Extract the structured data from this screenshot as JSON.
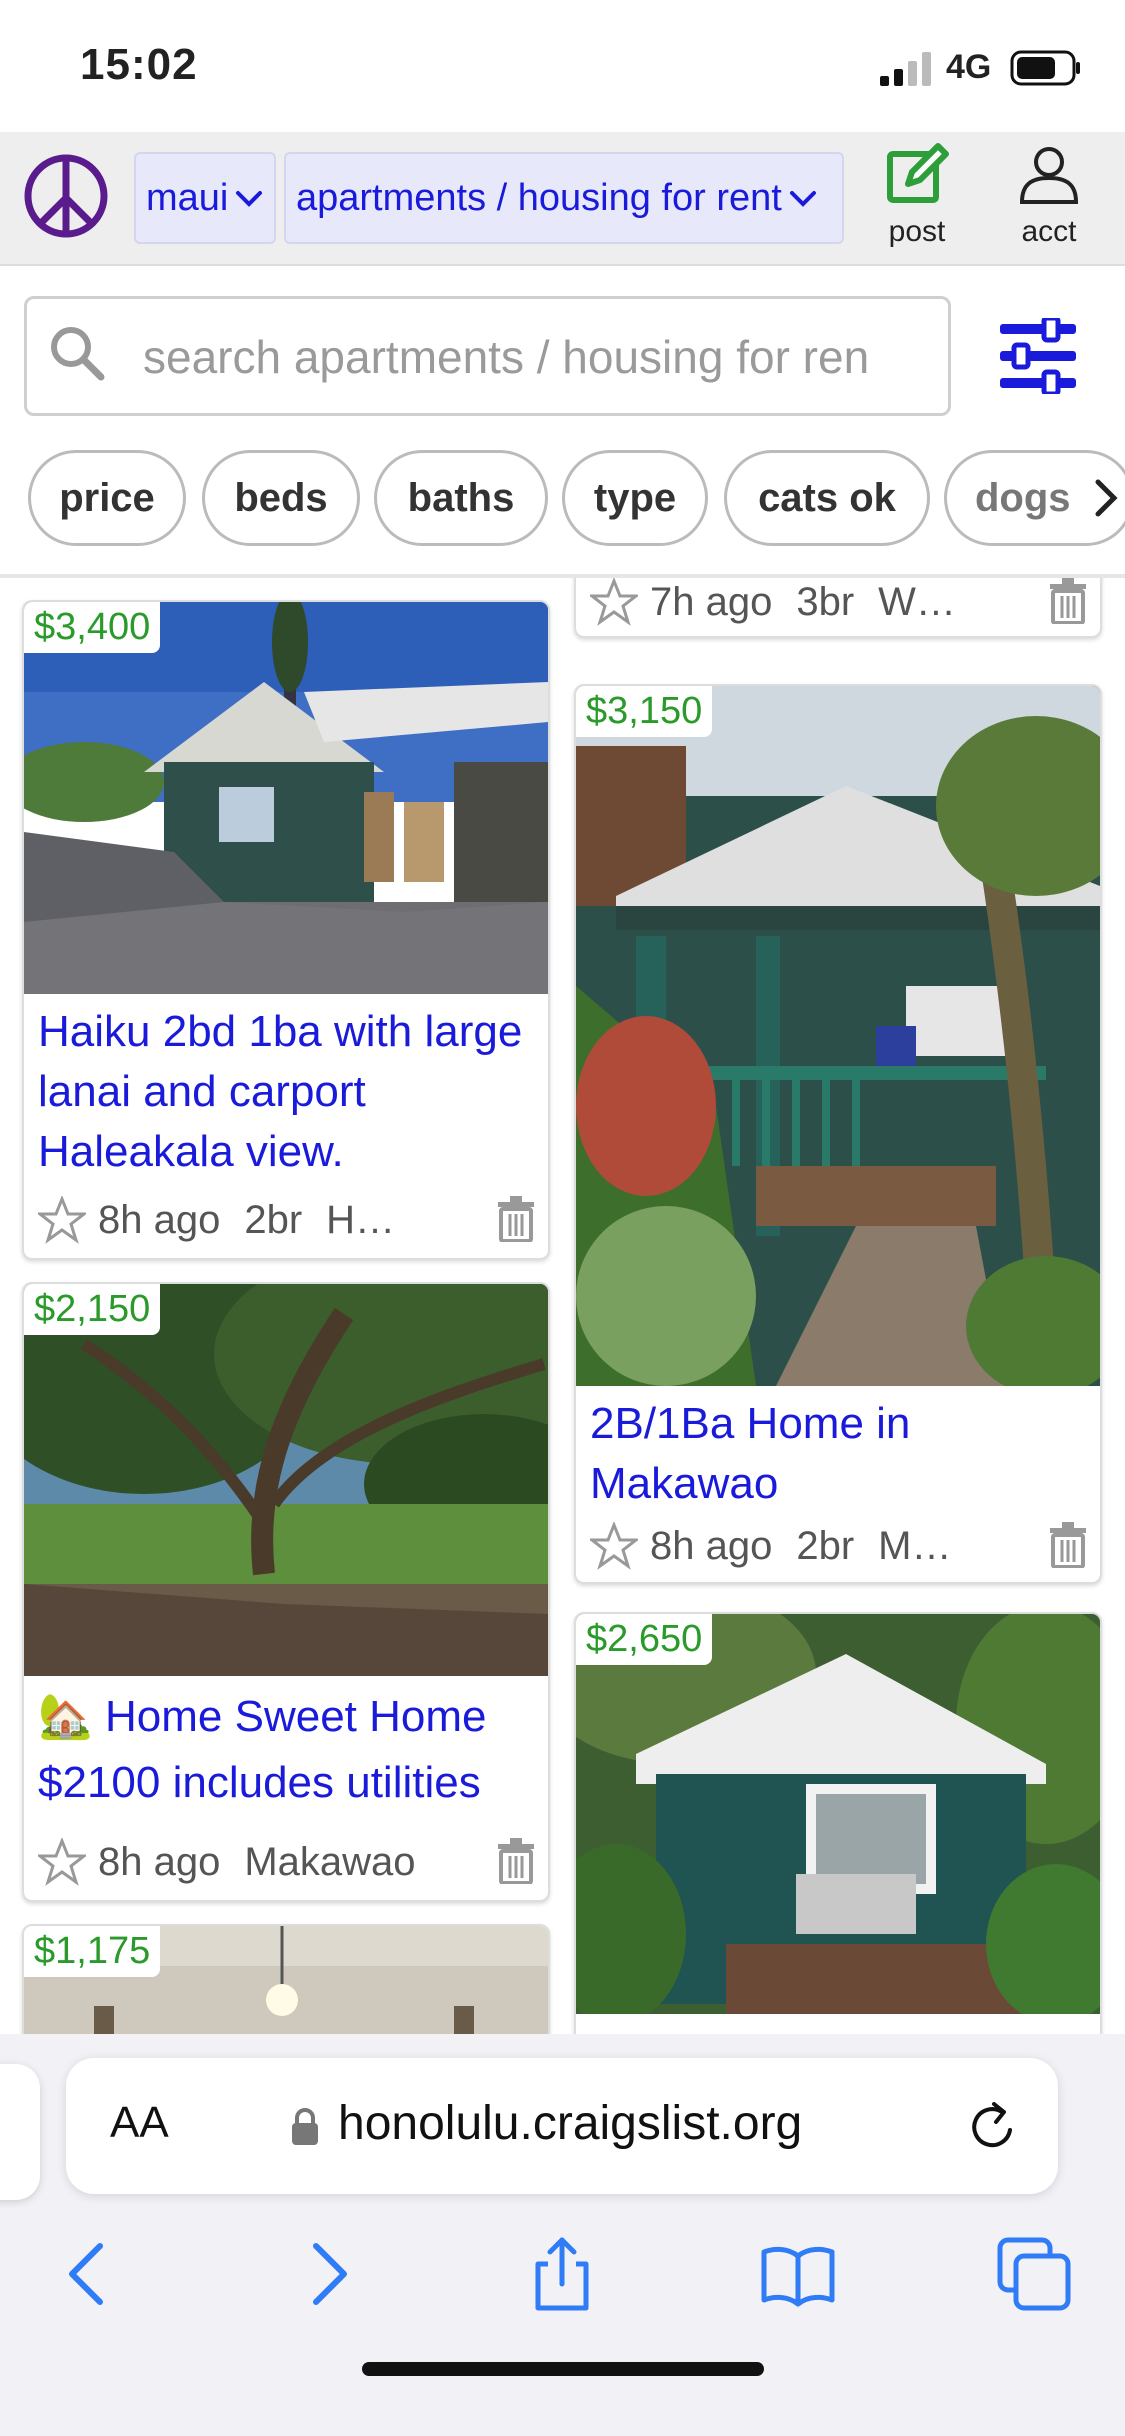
{
  "status": {
    "time": "15:02",
    "network": "4G"
  },
  "header": {
    "area": "maui",
    "category": "apartments / housing for rent",
    "post_label": "post",
    "acct_label": "acct"
  },
  "search": {
    "placeholder": "search apartments / housing for ren"
  },
  "filters": [
    "price",
    "beds",
    "baths",
    "type",
    "cats ok",
    "dogs"
  ],
  "listings_left": [
    {
      "price": "$3,400",
      "title": "Haiku 2bd 1ba with large lanai and carport Haleakala view.",
      "age": "8h ago",
      "beds": "2br",
      "area": "H…"
    },
    {
      "price": "$2,150",
      "title": "🏡 Home Sweet Home $2100 includes utilities",
      "age": "8h ago",
      "beds": "",
      "area": "Makawao"
    },
    {
      "price": "$1,175"
    }
  ],
  "listings_right": [
    {
      "age": "7h ago",
      "beds": "3br",
      "area": "W…"
    },
    {
      "price": "$3,150",
      "title": "2B/1Ba Home in Makawao",
      "age": "8h ago",
      "beds": "2br",
      "area": "M…"
    },
    {
      "price": "$2,650"
    }
  ],
  "browser": {
    "aa": "AA",
    "url": "honolulu.craigslist.org"
  },
  "colors": {
    "link": "#1a1adb",
    "price": "#2a9a2a",
    "peace": "#5a1c8c",
    "post": "#2e9e3a",
    "ios_blue": "#2f7cf6"
  }
}
